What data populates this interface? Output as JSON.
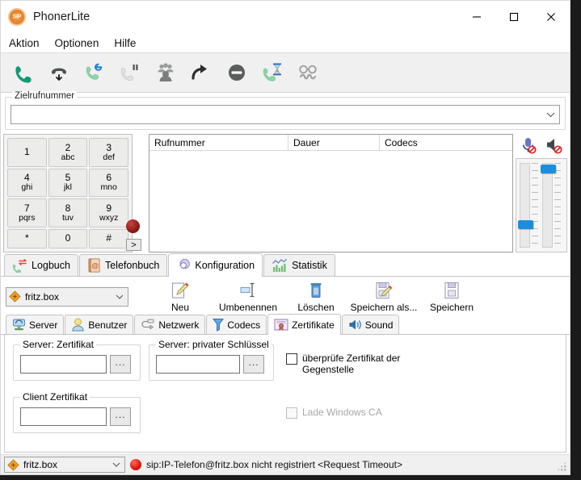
{
  "window": {
    "title": "PhonerLite",
    "logo_icon": "sip-logo-icon",
    "minimize_label": "—",
    "maximize_label": "☐",
    "close_label": "✕"
  },
  "menu": {
    "items": [
      {
        "label": "Aktion",
        "name": "menu-aktion"
      },
      {
        "label": "Optionen",
        "name": "menu-optionen"
      },
      {
        "label": "Hilfe",
        "name": "menu-hilfe"
      }
    ]
  },
  "toolbar": {
    "buttons": [
      {
        "icon": "answer-call-icon",
        "name": "answer-call-button"
      },
      {
        "icon": "hang-up-icon",
        "name": "hang-up-button"
      },
      {
        "icon": "redial-icon",
        "name": "redial-button"
      },
      {
        "icon": "hold-call-icon",
        "name": "hold-call-button"
      },
      {
        "icon": "conference-icon",
        "name": "conference-button"
      },
      {
        "icon": "transfer-call-icon",
        "name": "transfer-call-button"
      },
      {
        "icon": "do-not-disturb-icon",
        "name": "do-not-disturb-button"
      },
      {
        "icon": "call-waiting-icon",
        "name": "call-waiting-button"
      },
      {
        "icon": "anonymous-call-icon",
        "name": "anonymous-call-button"
      }
    ]
  },
  "destination": {
    "group_title": "Zielrufnummer",
    "value": "",
    "placeholder": ""
  },
  "dialpad": {
    "keys": [
      {
        "num": "1",
        "letters": ""
      },
      {
        "num": "2",
        "letters": "abc"
      },
      {
        "num": "3",
        "letters": "def"
      },
      {
        "num": "4",
        "letters": "ghi"
      },
      {
        "num": "5",
        "letters": "jkl"
      },
      {
        "num": "6",
        "letters": "mno"
      },
      {
        "num": "7",
        "letters": "pqrs"
      },
      {
        "num": "8",
        "letters": "tuv"
      },
      {
        "num": "9",
        "letters": "wxyz"
      },
      {
        "num": "*",
        "letters": ""
      },
      {
        "num": "0",
        "letters": ""
      },
      {
        "num": "#",
        "letters": ""
      }
    ],
    "record_icon": "record-button-icon",
    "expand_label": ">"
  },
  "call_list": {
    "columns": [
      "Rufnummer",
      "Dauer",
      "Codecs"
    ],
    "rows": []
  },
  "volume": {
    "mic_icon": "microphone-muted-icon",
    "speaker_icon": "speaker-muted-icon",
    "mic_level_percent": 22,
    "speaker_level_percent": 88,
    "thumb_color": "#1b8fdc"
  },
  "tabs": {
    "items": [
      {
        "label": "Logbuch",
        "icon": "call-log-icon",
        "active": false
      },
      {
        "label": "Telefonbuch",
        "icon": "address-book-icon",
        "active": false
      },
      {
        "label": "Konfiguration",
        "icon": "gear-icon",
        "active": true
      },
      {
        "label": "Statistik",
        "icon": "chart-icon",
        "active": false
      }
    ]
  },
  "config_toolbar": {
    "profile": {
      "value": "fritz.box",
      "icon": "profile-icon"
    },
    "buttons": [
      {
        "label": "Neu",
        "icon": "new-profile-icon"
      },
      {
        "label": "Umbenennen",
        "icon": "rename-icon"
      },
      {
        "label": "Löschen",
        "icon": "trash-icon"
      },
      {
        "label": "Speichern als...",
        "icon": "save-as-icon"
      },
      {
        "label": "Speichern",
        "icon": "save-icon"
      }
    ]
  },
  "sub_tabs": {
    "items": [
      {
        "label": "Server",
        "icon": "server-icon",
        "active": false
      },
      {
        "label": "Benutzer",
        "icon": "user-icon",
        "active": false
      },
      {
        "label": "Netzwerk",
        "icon": "network-icon",
        "active": false
      },
      {
        "label": "Codecs",
        "icon": "codec-funnel-icon",
        "active": false
      },
      {
        "label": "Zertifikate",
        "icon": "certificate-icon",
        "active": true
      },
      {
        "label": "Sound",
        "icon": "speaker-icon",
        "active": false
      }
    ]
  },
  "certificates": {
    "server_cert": {
      "title": "Server: Zertifikat",
      "value": "",
      "browse_label": "..."
    },
    "server_key": {
      "title": "Server: privater Schlüssel",
      "value": "",
      "browse_label": "..."
    },
    "client_cert": {
      "title": "Client Zertifikat",
      "value": "",
      "browse_label": "..."
    },
    "verify_peer": {
      "label": "überprüfe Zertifikat der Gegenstelle",
      "checked": false,
      "disabled": false
    },
    "load_windows_ca": {
      "label": "Lade Windows CA",
      "checked": false,
      "disabled": true
    }
  },
  "status_bar": {
    "profile": "fritz.box",
    "led_color": "#e01b10",
    "message": "sip:IP-Telefon@fritz.box nicht registriert <Request Timeout>"
  }
}
